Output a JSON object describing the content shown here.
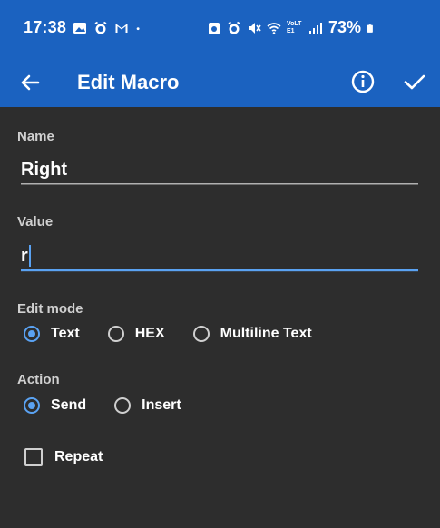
{
  "status_bar": {
    "time": "17:38",
    "battery": "73%",
    "left_icons": [
      "image-icon",
      "alarm-icon",
      "gmail-icon",
      "dot-icon"
    ],
    "right_icons": [
      "alarm-icon",
      "alarm-icon",
      "mute-icon",
      "wifi-icon",
      "volte-icon",
      "signal-icon",
      "battery-icon"
    ],
    "volte_text": "VoLTE1"
  },
  "app_bar": {
    "title": "Edit Macro",
    "color": "#1b62c0"
  },
  "form": {
    "name_label": "Name",
    "name_value": "Right",
    "value_label": "Value",
    "value_value": "r",
    "accent_color": "#5aa2f2"
  },
  "edit_mode": {
    "label": "Edit mode",
    "options": [
      "Text",
      "HEX",
      "Multiline Text"
    ],
    "selected": "Text"
  },
  "action": {
    "label": "Action",
    "options": [
      "Send",
      "Insert"
    ],
    "selected": "Send"
  },
  "repeat": {
    "label": "Repeat",
    "checked": false
  }
}
